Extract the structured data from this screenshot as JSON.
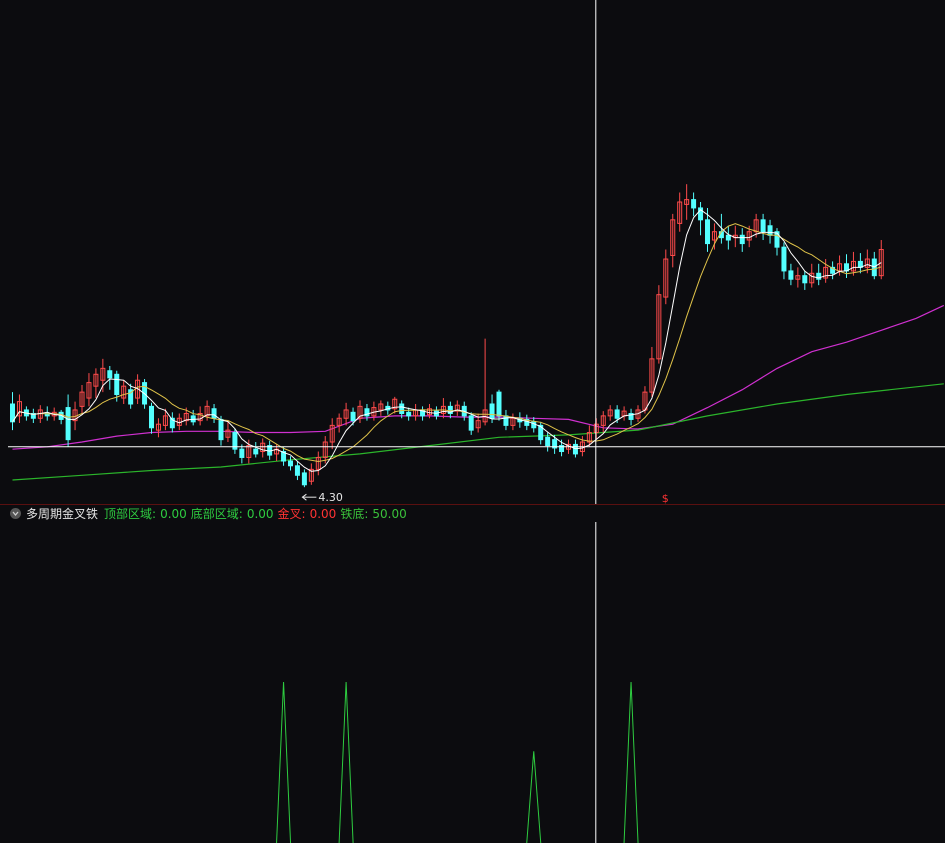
{
  "indicator": {
    "name": "多周期金叉铁",
    "items": [
      {
        "label": "顶部区域:",
        "value": "0.00",
        "color": "#2ecc40"
      },
      {
        "label": "底部区域:",
        "value": "0.00",
        "color": "#2ecc40"
      },
      {
        "label": "金叉:",
        "value": "0.00",
        "color": "#ff3333"
      },
      {
        "label": "铁底:",
        "value": "50.00",
        "color": "#3ac03a"
      }
    ]
  },
  "colors": {
    "background": "#0c0c0f",
    "up_candle": "#ff4b4b",
    "down_candle": "#54ffff",
    "ma_short": "#ffffff",
    "ma_mid": "#e0c34a",
    "ma_long": "#d030d0",
    "ma_longest": "#2bb52b",
    "signal": "#2ecc40",
    "crosshair": "#ffffff"
  },
  "chart_data": [
    {
      "type": "candlestick",
      "title": "",
      "low_label": "4.30",
      "marker_symbol": "$",
      "crosshair_index": 84,
      "crosshair_price": 4.64,
      "ylim": [
        4.15,
        8.4
      ],
      "candles": [
        [
          5.0,
          4.85,
          5.1,
          4.78
        ],
        [
          4.9,
          5.02,
          5.08,
          4.84
        ],
        [
          4.95,
          4.9,
          4.98,
          4.86
        ],
        [
          4.92,
          4.88,
          4.96,
          4.84
        ],
        [
          4.88,
          4.95,
          4.99,
          4.84
        ],
        [
          4.92,
          4.9,
          4.98,
          4.86
        ],
        [
          4.9,
          4.93,
          4.97,
          4.86
        ],
        [
          4.93,
          4.87,
          4.95,
          4.83
        ],
        [
          4.97,
          4.7,
          5.08,
          4.64
        ],
        [
          4.86,
          4.95,
          5.02,
          4.78
        ],
        [
          4.98,
          5.1,
          5.16,
          4.92
        ],
        [
          5.05,
          5.18,
          5.26,
          4.98
        ],
        [
          5.15,
          5.25,
          5.3,
          5.05
        ],
        [
          5.2,
          5.3,
          5.38,
          5.1
        ],
        [
          5.28,
          5.22,
          5.32,
          5.12
        ],
        [
          5.25,
          5.08,
          5.28,
          5.02
        ],
        [
          5.05,
          5.15,
          5.2,
          5.0
        ],
        [
          5.12,
          5.0,
          5.17,
          4.96
        ],
        [
          5.05,
          5.2,
          5.25,
          5.0
        ],
        [
          5.18,
          5.0,
          5.21,
          4.96
        ],
        [
          4.98,
          4.8,
          5.01,
          4.75
        ],
        [
          4.78,
          4.83,
          4.88,
          4.72
        ],
        [
          4.82,
          4.9,
          4.96,
          4.78
        ],
        [
          4.88,
          4.8,
          4.93,
          4.76
        ],
        [
          4.82,
          4.88,
          4.92,
          4.78
        ],
        [
          4.86,
          4.92,
          4.97,
          4.82
        ],
        [
          4.9,
          4.85,
          4.95,
          4.82
        ],
        [
          4.86,
          4.92,
          4.98,
          4.82
        ],
        [
          4.9,
          4.98,
          5.03,
          4.86
        ],
        [
          4.96,
          4.88,
          5.0,
          4.84
        ],
        [
          4.87,
          4.7,
          4.9,
          4.65
        ],
        [
          4.72,
          4.78,
          4.85,
          4.68
        ],
        [
          4.76,
          4.62,
          4.79,
          4.58
        ],
        [
          4.62,
          4.55,
          4.66,
          4.5
        ],
        [
          4.55,
          4.65,
          4.7,
          4.5
        ],
        [
          4.62,
          4.58,
          4.68,
          4.55
        ],
        [
          4.6,
          4.67,
          4.71,
          4.55
        ],
        [
          4.65,
          4.57,
          4.69,
          4.53
        ],
        [
          4.58,
          4.62,
          4.66,
          4.52
        ],
        [
          4.6,
          4.52,
          4.64,
          4.48
        ],
        [
          4.52,
          4.48,
          4.56,
          4.44
        ],
        [
          4.48,
          4.4,
          4.52,
          4.36
        ],
        [
          4.42,
          4.32,
          4.45,
          4.3
        ],
        [
          4.35,
          4.45,
          4.5,
          4.32
        ],
        [
          4.45,
          4.55,
          4.6,
          4.4
        ],
        [
          4.55,
          4.68,
          4.73,
          4.5
        ],
        [
          4.68,
          4.82,
          4.88,
          4.62
        ],
        [
          4.82,
          4.88,
          4.92,
          4.76
        ],
        [
          4.88,
          4.95,
          5.01,
          4.82
        ],
        [
          4.93,
          4.86,
          4.97,
          4.82
        ],
        [
          4.88,
          4.98,
          5.03,
          4.84
        ],
        [
          4.96,
          4.9,
          5.0,
          4.86
        ],
        [
          4.9,
          4.97,
          5.02,
          4.86
        ],
        [
          4.95,
          5.0,
          5.03,
          4.9
        ],
        [
          4.98,
          4.95,
          5.02,
          4.91
        ],
        [
          4.96,
          5.04,
          5.06,
          4.92
        ],
        [
          5.0,
          4.92,
          5.03,
          4.88
        ],
        [
          4.93,
          4.9,
          4.97,
          4.86
        ],
        [
          4.9,
          4.95,
          5.0,
          4.86
        ],
        [
          4.95,
          4.9,
          4.98,
          4.86
        ],
        [
          4.91,
          4.96,
          5.0,
          4.88
        ],
        [
          4.94,
          4.9,
          4.98,
          4.87
        ],
        [
          4.92,
          4.98,
          5.05,
          4.88
        ],
        [
          4.98,
          4.92,
          5.02,
          4.88
        ],
        [
          4.94,
          4.99,
          5.03,
          4.9
        ],
        [
          4.98,
          4.9,
          5.02,
          4.86
        ],
        [
          4.9,
          4.78,
          4.93,
          4.74
        ],
        [
          4.8,
          4.86,
          4.92,
          4.76
        ],
        [
          4.85,
          4.95,
          5.55,
          4.82
        ],
        [
          5.0,
          4.88,
          5.08,
          4.84
        ],
        [
          5.1,
          4.9,
          5.12,
          4.86
        ],
        [
          4.9,
          4.82,
          4.95,
          4.78
        ],
        [
          4.82,
          4.88,
          4.92,
          4.78
        ],
        [
          4.88,
          4.85,
          4.93,
          4.8
        ],
        [
          4.87,
          4.82,
          4.91,
          4.78
        ],
        [
          4.85,
          4.8,
          4.89,
          4.76
        ],
        [
          4.82,
          4.7,
          4.85,
          4.66
        ],
        [
          4.72,
          4.65,
          4.76,
          4.6
        ],
        [
          4.7,
          4.63,
          4.74,
          4.58
        ],
        [
          4.65,
          4.6,
          4.7,
          4.56
        ],
        [
          4.62,
          4.66,
          4.7,
          4.58
        ],
        [
          4.66,
          4.58,
          4.7,
          4.55
        ],
        [
          4.6,
          4.68,
          4.73,
          4.56
        ],
        [
          4.68,
          4.76,
          4.82,
          4.64
        ],
        [
          4.76,
          4.83,
          4.88,
          4.7
        ],
        [
          4.82,
          4.9,
          4.94,
          4.76
        ],
        [
          4.9,
          4.95,
          4.99,
          4.86
        ],
        [
          4.95,
          4.88,
          4.99,
          4.84
        ],
        [
          4.9,
          4.94,
          4.98,
          4.86
        ],
        [
          4.92,
          4.87,
          4.96,
          4.82
        ],
        [
          4.88,
          4.95,
          4.99,
          4.85
        ],
        [
          4.95,
          5.1,
          5.15,
          4.92
        ],
        [
          5.1,
          5.38,
          5.48,
          5.06
        ],
        [
          5.38,
          5.92,
          6.0,
          5.34
        ],
        [
          5.9,
          6.22,
          6.3,
          5.84
        ],
        [
          6.25,
          6.55,
          6.6,
          6.15
        ],
        [
          6.52,
          6.7,
          6.78,
          6.45
        ],
        [
          6.68,
          6.72,
          6.85,
          6.55
        ],
        [
          6.72,
          6.65,
          6.78,
          6.58
        ],
        [
          6.65,
          6.55,
          6.7,
          6.42
        ],
        [
          6.55,
          6.35,
          6.65,
          6.28
        ],
        [
          6.38,
          6.45,
          6.52,
          6.3
        ],
        [
          6.45,
          6.4,
          6.6,
          6.35
        ],
        [
          6.42,
          6.38,
          6.5,
          6.3
        ],
        [
          6.4,
          6.42,
          6.5,
          6.32
        ],
        [
          6.42,
          6.35,
          6.48,
          6.28
        ],
        [
          6.38,
          6.45,
          6.5,
          6.32
        ],
        [
          6.45,
          6.55,
          6.6,
          6.4
        ],
        [
          6.55,
          6.45,
          6.6,
          6.38
        ],
        [
          6.5,
          6.42,
          6.55,
          6.35
        ],
        [
          6.45,
          6.32,
          6.48,
          6.25
        ],
        [
          6.32,
          6.12,
          6.36,
          6.05
        ],
        [
          6.12,
          6.05,
          6.18,
          6.0
        ],
        [
          6.05,
          6.08,
          6.15,
          5.98
        ],
        [
          6.08,
          6.02,
          6.12,
          5.96
        ],
        [
          6.02,
          6.1,
          6.18,
          5.98
        ],
        [
          6.1,
          6.05,
          6.18,
          6.0
        ],
        [
          6.06,
          6.15,
          6.22,
          6.02
        ],
        [
          6.15,
          6.1,
          6.2,
          6.05
        ],
        [
          6.12,
          6.18,
          6.25,
          6.08
        ],
        [
          6.18,
          6.12,
          6.26,
          6.06
        ],
        [
          6.12,
          6.2,
          6.28,
          6.08
        ],
        [
          6.2,
          6.15,
          6.27,
          6.1
        ],
        [
          6.15,
          6.22,
          6.3,
          6.1
        ],
        [
          6.22,
          6.08,
          6.28,
          6.05
        ],
        [
          6.08,
          6.3,
          6.38,
          6.05
        ]
      ],
      "ma_long": [
        [
          0,
          4.62
        ],
        [
          5,
          4.64
        ],
        [
          10,
          4.68
        ],
        [
          15,
          4.73
        ],
        [
          20,
          4.76
        ],
        [
          25,
          4.77
        ],
        [
          30,
          4.77
        ],
        [
          35,
          4.76
        ],
        [
          40,
          4.76
        ],
        [
          45,
          4.77
        ],
        [
          50,
          4.88
        ],
        [
          55,
          4.9
        ],
        [
          60,
          4.9
        ],
        [
          65,
          4.89
        ],
        [
          70,
          4.89
        ],
        [
          75,
          4.88
        ],
        [
          80,
          4.87
        ],
        [
          85,
          4.8
        ],
        [
          90,
          4.79
        ],
        [
          95,
          4.83
        ],
        [
          100,
          4.97
        ],
        [
          105,
          5.12
        ],
        [
          110,
          5.3
        ],
        [
          115,
          5.44
        ],
        [
          120,
          5.52
        ],
        [
          125,
          5.62
        ],
        [
          130,
          5.72
        ],
        [
          134,
          5.83
        ]
      ],
      "ma_longest": [
        [
          0,
          4.36
        ],
        [
          10,
          4.4
        ],
        [
          20,
          4.44
        ],
        [
          30,
          4.47
        ],
        [
          40,
          4.53
        ],
        [
          50,
          4.58
        ],
        [
          60,
          4.65
        ],
        [
          70,
          4.72
        ],
        [
          80,
          4.74
        ],
        [
          90,
          4.78
        ],
        [
          100,
          4.9
        ],
        [
          110,
          5.0
        ],
        [
          120,
          5.08
        ],
        [
          134,
          5.17
        ]
      ],
      "signal": [
        {
          "x": 39,
          "y": 1
        },
        {
          "x": 48,
          "y": 1
        },
        {
          "x": 75,
          "y": 0.57
        },
        {
          "x": 89,
          "y": 1
        }
      ],
      "signal_ylim": [
        0,
        1
      ]
    }
  ]
}
